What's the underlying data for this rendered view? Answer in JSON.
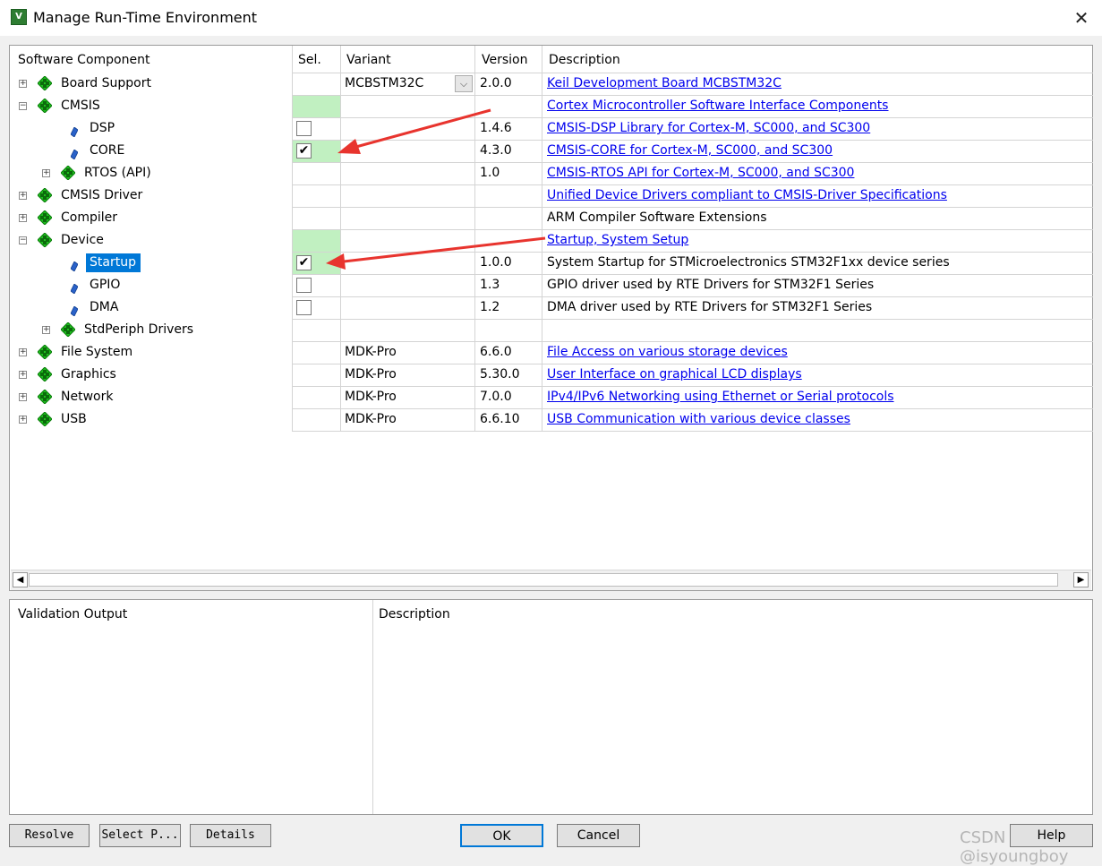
{
  "window": {
    "title": "Manage Run-Time Environment",
    "close": "✕"
  },
  "columns": {
    "component": "Software Component",
    "sel": "Sel.",
    "variant": "Variant",
    "version": "Version",
    "description": "Description"
  },
  "rows": [
    {
      "label": "Board Support",
      "variant": "MCBSTM32C",
      "version": "2.0.0",
      "description": "Keil Development Board MCBSTM32C",
      "link": true
    },
    {
      "label": "CMSIS",
      "variant": "",
      "version": "",
      "description": "Cortex Microcontroller Software Interface Components",
      "link": true
    },
    {
      "label": "DSP",
      "variant": "",
      "version": "1.4.6",
      "description": "CMSIS-DSP Library for Cortex-M, SC000, and SC300",
      "link": true,
      "checked": false
    },
    {
      "label": "CORE",
      "variant": "",
      "version": "4.3.0",
      "description": "CMSIS-CORE for Cortex-M, SC000, and SC300",
      "link": true,
      "checked": true
    },
    {
      "label": "RTOS (API)",
      "variant": "",
      "version": "1.0",
      "description": "CMSIS-RTOS API for Cortex-M, SC000, and SC300",
      "link": true
    },
    {
      "label": "CMSIS Driver",
      "variant": "",
      "version": "",
      "description": "Unified Device Drivers compliant to CMSIS-Driver Specifications",
      "link": true
    },
    {
      "label": "Compiler",
      "variant": "",
      "version": "",
      "description": "ARM Compiler Software Extensions",
      "link": false
    },
    {
      "label": "Device",
      "variant": "",
      "version": "",
      "description": "Startup, System Setup",
      "link": true
    },
    {
      "label": "Startup",
      "variant": "",
      "version": "1.0.0",
      "description": "System Startup for STMicroelectronics STM32F1xx device series",
      "link": false,
      "checked": true
    },
    {
      "label": "GPIO",
      "variant": "",
      "version": "1.3",
      "description": "GPIO driver used by RTE Drivers for STM32F1 Series",
      "link": false,
      "checked": false
    },
    {
      "label": "DMA",
      "variant": "",
      "version": "1.2",
      "description": "DMA driver used by RTE Drivers for STM32F1 Series",
      "link": false,
      "checked": false
    },
    {
      "label": "StdPeriph Drivers",
      "variant": "",
      "version": "",
      "description": "",
      "link": false
    },
    {
      "label": "File System",
      "variant": "MDK-Pro",
      "version": "6.6.0",
      "description": "File Access on various storage devices",
      "link": true
    },
    {
      "label": "Graphics",
      "variant": "MDK-Pro",
      "version": "5.30.0",
      "description": "User Interface on graphical LCD displays",
      "link": true
    },
    {
      "label": "Network",
      "variant": "MDK-Pro",
      "version": "7.0.0",
      "description": "IPv4/IPv6 Networking using Ethernet or Serial protocols",
      "link": true
    },
    {
      "label": "USB",
      "variant": "MDK-Pro",
      "version": "6.6.10",
      "description": "USB Communication with various device classes",
      "link": true
    }
  ],
  "bottom": {
    "validation": "Validation Output",
    "description": "Description"
  },
  "buttons": {
    "resolve": "Resolve",
    "select": "Select P...",
    "details": "Details",
    "ok": "OK",
    "cancel": "Cancel",
    "help": "Help"
  },
  "watermark": "CSDN @isyoungboy",
  "colors": {
    "selection": "#0078d7",
    "green_cell": "#c1f0c1",
    "link": "#0000ee",
    "arrow": "#e8342e"
  }
}
